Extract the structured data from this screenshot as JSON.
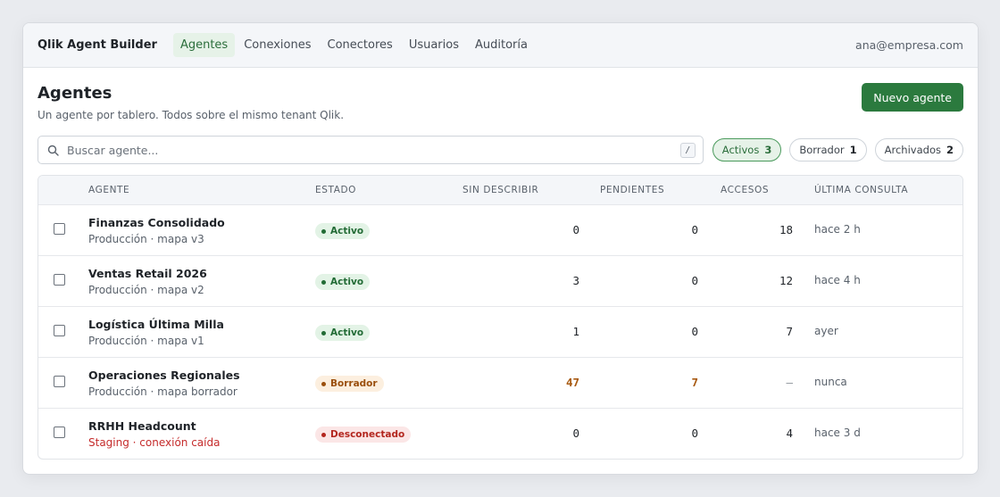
{
  "nav": {
    "brand": "Qlik Agent Builder",
    "links": [
      "Agentes",
      "Conexiones",
      "Conectores",
      "Usuarios",
      "Auditoría"
    ],
    "user": "ana@empresa.com"
  },
  "header": {
    "title": "Agentes",
    "subtitle": "Un agente por tablero. Todos sobre el mismo tenant Qlik.",
    "new_button": "Nuevo agente"
  },
  "search": {
    "placeholder": "Buscar agente...",
    "shortcut": "/"
  },
  "filters": [
    {
      "label": "Activos",
      "count": "3",
      "active": true
    },
    {
      "label": "Borrador",
      "count": "1",
      "active": false
    },
    {
      "label": "Archivados",
      "count": "2",
      "active": false
    }
  ],
  "table": {
    "columns": [
      "AGENTE",
      "ESTADO",
      "SIN DESCRIBIR",
      "PENDIENTES",
      "ACCESOS",
      "ÚLTIMA CONSULTA"
    ],
    "rows": [
      {
        "name": "Finanzas Consolidado",
        "sub": "Producción · mapa v3",
        "status": "Activo",
        "sin_describir": "0",
        "pendientes": "0",
        "accesos": "18",
        "ultima": "hace 2 h"
      },
      {
        "name": "Ventas Retail 2026",
        "sub": "Producción · mapa v2",
        "status": "Activo",
        "sin_describir": "3",
        "pendientes": "0",
        "accesos": "12",
        "ultima": "hace 4 h"
      },
      {
        "name": "Logística Última Milla",
        "sub": "Producción · mapa v1",
        "status": "Activo",
        "sin_describir": "1",
        "pendientes": "0",
        "accesos": "7",
        "ultima": "ayer"
      },
      {
        "name": "Operaciones Regionales",
        "sub": "Producción · mapa borrador",
        "status": "Borrador",
        "sin_describir": "47",
        "pendientes": "7",
        "accesos": "—",
        "ultima": "nunca"
      },
      {
        "name": "RRHH Headcount",
        "sub": "Staging · conexión caída",
        "status": "Desconectado",
        "sin_describir": "0",
        "pendientes": "0",
        "accesos": "4",
        "ultima": "hace 3 d"
      }
    ]
  },
  "colors": {
    "accent": "#2b7a3e",
    "activo_bg": "#e3f3e6",
    "activo_fg": "#226b35",
    "borrador_bg": "#fcefdf",
    "borrador_fg": "#9a4f0d",
    "desconectado_bg": "#fbe6e6",
    "desconectado_fg": "#b3261e",
    "warning_number": "#a85a10"
  },
  "icons": {
    "search": "search-icon"
  }
}
